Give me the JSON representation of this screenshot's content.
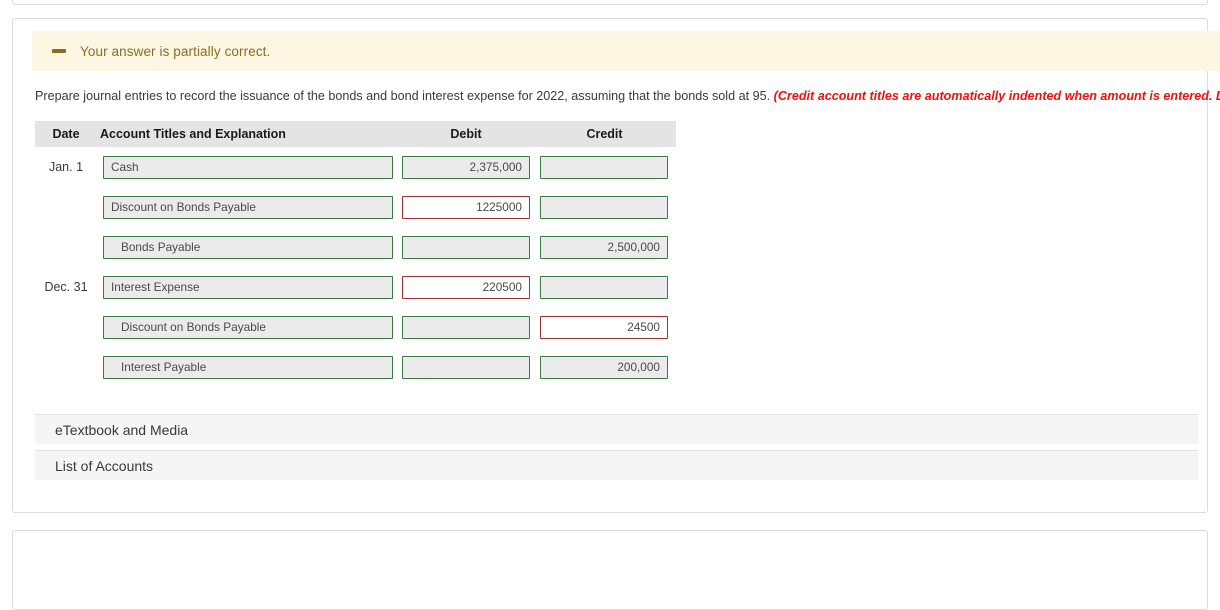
{
  "alert": {
    "icon": "minus-dash-icon",
    "message": "Your answer is partially correct.",
    "bg_color": "#fdf6e3",
    "text_color": "#8a6d24"
  },
  "instruction": {
    "main": "Prepare journal entries to record the issuance of the bonds and bond interest expense for 2022, assuming that the bonds sold at 95. ",
    "emphasis": "(Credit account titles are automatically indented when amount is entered. Do not indent manually.)",
    "emphasis_color": "#ee1111"
  },
  "table": {
    "headers": {
      "date": "Date",
      "account": "Account Titles and Explanation",
      "debit": "Debit",
      "credit": "Credit"
    },
    "rows": [
      {
        "date": "Jan. 1",
        "account": "Cash",
        "account_indent": false,
        "account_state": "correct",
        "debit": "2,375,000",
        "debit_state": "correct",
        "credit": "",
        "credit_state": "correct"
      },
      {
        "date": "",
        "account": "Discount on Bonds Payable",
        "account_indent": false,
        "account_state": "correct",
        "debit": "1225000",
        "debit_state": "incorrect",
        "credit": "",
        "credit_state": "correct"
      },
      {
        "date": "",
        "account": "Bonds Payable",
        "account_indent": true,
        "account_state": "correct",
        "debit": "",
        "debit_state": "correct",
        "credit": "2,500,000",
        "credit_state": "correct"
      },
      {
        "date": "Dec. 31",
        "account": "Interest Expense",
        "account_indent": false,
        "account_state": "correct",
        "debit": "220500",
        "debit_state": "incorrect",
        "credit": "",
        "credit_state": "correct"
      },
      {
        "date": "",
        "account": "Discount on Bonds Payable",
        "account_indent": true,
        "account_state": "correct",
        "debit": "",
        "debit_state": "correct",
        "credit": "24500",
        "credit_state": "incorrect"
      },
      {
        "date": "",
        "account": "Interest Payable",
        "account_indent": true,
        "account_state": "correct",
        "debit": "",
        "debit_state": "correct",
        "credit": "200,000",
        "credit_state": "correct"
      }
    ]
  },
  "footer": {
    "etextbook_label": "eTextbook and Media",
    "list_of_accounts_label": "List of Accounts"
  },
  "colors": {
    "correct_border": "#3f7744",
    "incorrect_border": "#a33030",
    "field_bg": "#ebebeb",
    "header_bg": "#e4e4e4"
  }
}
